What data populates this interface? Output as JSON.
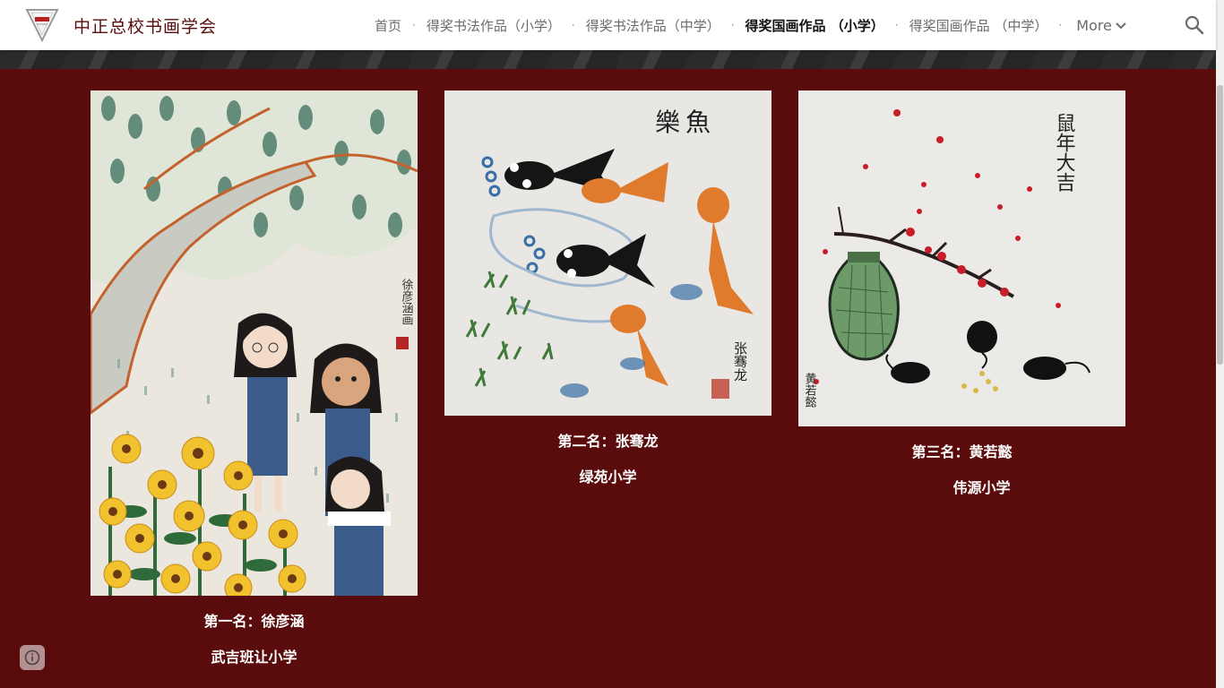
{
  "site": {
    "title": "中正总校书画学会"
  },
  "nav": {
    "items": [
      {
        "label": "首页",
        "active": false
      },
      {
        "label": "得奖书法作品（小学）",
        "active": false
      },
      {
        "label": "得奖书法作品（中学）",
        "active": false
      },
      {
        "label": "得奖国画作品 （小学）",
        "active": true
      },
      {
        "label": "得奖国画作品 （中学）",
        "active": false
      }
    ],
    "more_label": "More"
  },
  "colors": {
    "brand": "#5a0b0b",
    "header_bg": "#ffffff"
  },
  "gallery": [
    {
      "place": "第一名：徐彦涵",
      "school": "武吉班让小学"
    },
    {
      "place": "第二名：张骞龙",
      "school": "绿苑小学"
    },
    {
      "place": "第三名：黄若懿",
      "school": "伟源小学"
    }
  ],
  "artwork_text": {
    "fish_title": "樂魚",
    "fish_signature": "张骞龙",
    "mouse_title": "鼠年大吉",
    "mouse_signature": "黄若懿",
    "girls_signature": "徐彦涵画"
  }
}
